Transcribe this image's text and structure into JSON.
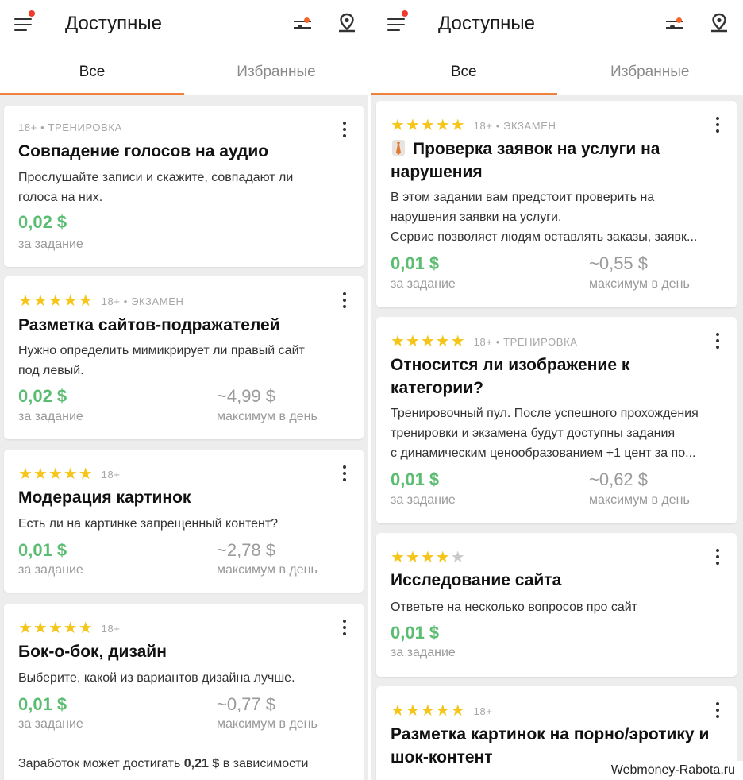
{
  "header": {
    "title": "Доступные",
    "tabs": [
      "Все",
      "Избранные"
    ]
  },
  "left": {
    "cards": [
      {
        "rating": null,
        "meta": "18+  •  ТРЕНИРОВКА",
        "title": "Совпадение голосов на аудио",
        "desc": [
          "Прослушайте записи и скажите, совпадают ли",
          "голоса на них."
        ],
        "price": "0,02 $",
        "price_label": "за задание",
        "max": null,
        "max_label": null
      },
      {
        "rating": 5,
        "meta": "18+  •  ЭКЗАМЕН",
        "title": "Разметка сайтов-подражателей",
        "desc": [
          "Нужно определить мимикрирует ли правый сайт",
          "под левый."
        ],
        "price": "0,02 $",
        "price_label": "за задание",
        "max": "~4,99 $",
        "max_label": "максимум в день"
      },
      {
        "rating": 5,
        "meta": "18+",
        "title": "Модерация картинок",
        "desc": [
          "Есть ли на картинке запрещенный контент?"
        ],
        "price": "0,01 $",
        "price_label": "за задание",
        "max": "~2,78 $",
        "max_label": "максимум в день"
      },
      {
        "rating": 5,
        "meta": "18+",
        "title": "Бок-о-бок, дизайн",
        "desc": [
          "Выберите, какой из вариантов дизайна лучше."
        ],
        "price": "0,01 $",
        "price_label": "за задание",
        "max": "~0,77 $",
        "max_label": "максимум в день"
      }
    ],
    "footer": {
      "before": "Заработок может достигать ",
      "bold": "0,21 $",
      "after": " в зависимости"
    }
  },
  "right": {
    "cards": [
      {
        "rating": 5,
        "meta": "18+  •  ЭКЗАМЕН",
        "title": [
          "Проверка заявок на услуги на",
          "нарушения"
        ],
        "desc": [
          "В этом задании вам предстоит проверить на",
          "нарушения заявки на услуги.",
          "Сервис позволяет людям оставлять заказы, заявк..."
        ],
        "price": "0,01 $",
        "price_label": "за задание",
        "max": "~0,55 $",
        "max_label": "максимум в день"
      },
      {
        "rating": 5,
        "meta": "18+  •  ТРЕНИРОВКА",
        "title": [
          "Относится ли изображение к",
          "категории?"
        ],
        "desc": [
          "Тренировочный пул. После успешного прохождения",
          "тренировки и экзамена будут доступны задания",
          "с динамическим ценообразованием +1 цент за по..."
        ],
        "price": "0,01 $",
        "price_label": "за задание",
        "max": "~0,62 $",
        "max_label": "максимум в день"
      },
      {
        "rating": 4,
        "meta": "",
        "title": [
          "Исследование сайта"
        ],
        "desc": [
          "Ответьте на несколько вопросов про сайт"
        ],
        "price": "0,01 $",
        "price_label": "за задание",
        "max": null,
        "max_label": null
      },
      {
        "rating": 5,
        "meta": "18+",
        "title": [
          "Разметка картинок на порно/эротику и",
          "шок-контент"
        ],
        "desc": [],
        "price": null,
        "price_label": null,
        "max": null,
        "max_label": null
      }
    ]
  },
  "watermark": "Webmoney-Rabota.ru",
  "colors": {
    "accent": "#f2803d",
    "price": "#5bbd72",
    "star": "#f5c518",
    "notification": "#f2392c"
  }
}
